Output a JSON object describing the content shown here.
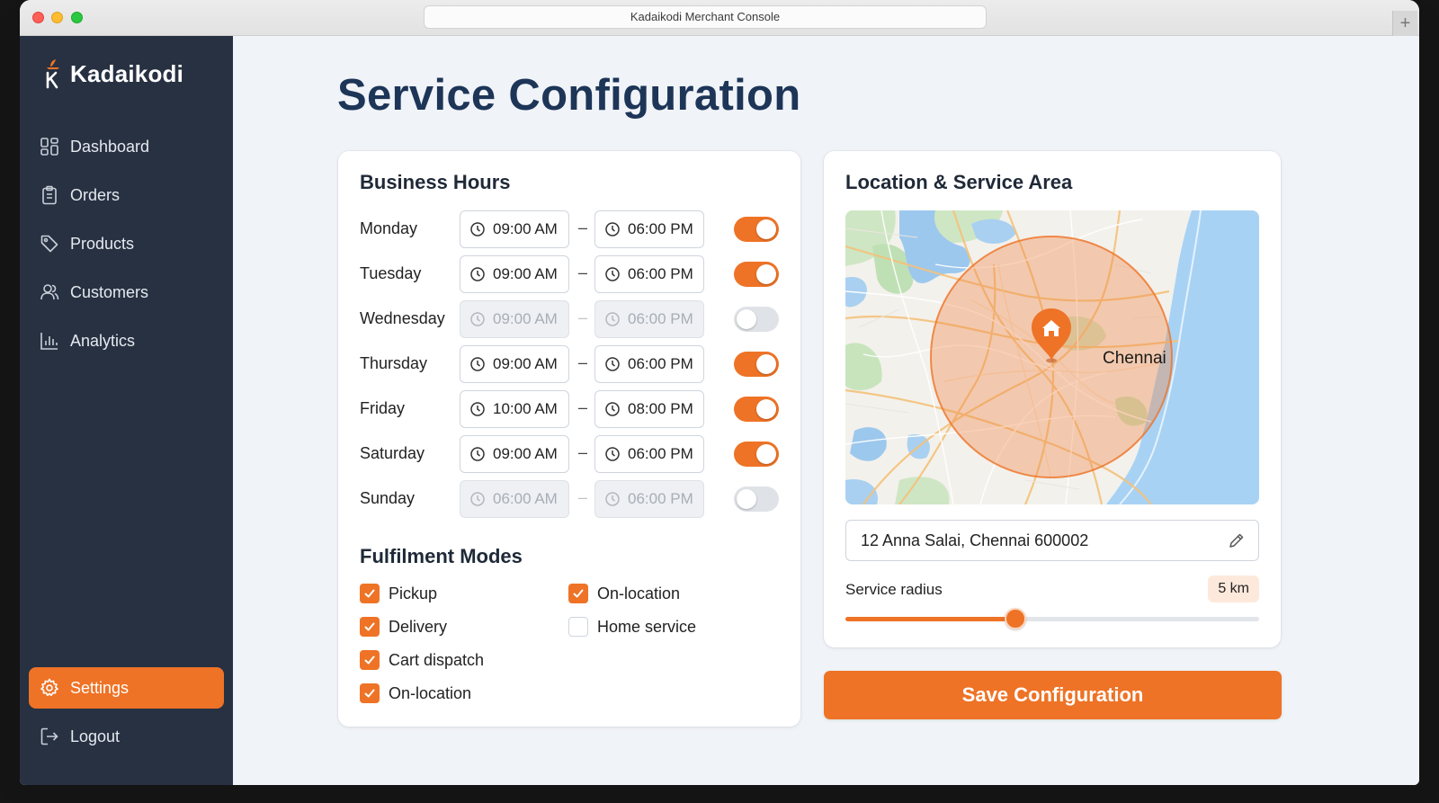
{
  "window": {
    "title": "Kadaikodi Merchant Console",
    "new_tab": "+"
  },
  "brand": {
    "name": "Kadaikodi"
  },
  "sidebar": {
    "items": [
      {
        "label": "Dashboard",
        "icon": "dashboard-icon"
      },
      {
        "label": "Orders",
        "icon": "clipboard-icon"
      },
      {
        "label": "Products",
        "icon": "tag-icon"
      },
      {
        "label": "Customers",
        "icon": "users-icon"
      },
      {
        "label": "Analytics",
        "icon": "bar-chart-icon"
      },
      {
        "label": "Settings",
        "icon": "gear-icon",
        "active": true
      },
      {
        "label": "Logout",
        "icon": "logout-icon"
      }
    ]
  },
  "page": {
    "title": "Service Configuration"
  },
  "business_hours": {
    "title": "Business Hours",
    "separator": "–",
    "days": [
      {
        "name": "Monday",
        "open": "09:00 AM",
        "close": "06:00 PM",
        "enabled": true
      },
      {
        "name": "Tuesday",
        "open": "09:00 AM",
        "close": "06:00 PM",
        "enabled": true
      },
      {
        "name": "Wednesday",
        "open": "09:00 AM",
        "close": "06:00 PM",
        "enabled": false
      },
      {
        "name": "Thursday",
        "open": "09:00 AM",
        "close": "06:00 PM",
        "enabled": true
      },
      {
        "name": "Friday",
        "open": "10:00 AM",
        "close": "08:00 PM",
        "enabled": true
      },
      {
        "name": "Saturday",
        "open": "09:00 AM",
        "close": "06:00 PM",
        "enabled": true
      },
      {
        "name": "Sunday",
        "open": "06:00 AM",
        "close": "06:00 PM",
        "enabled": false
      }
    ]
  },
  "fulfilment": {
    "title": "Fulfilment Modes",
    "options": [
      {
        "label": "Pickup",
        "checked": true
      },
      {
        "label": "Delivery",
        "checked": true
      },
      {
        "label": "Cart dispatch",
        "checked": true
      },
      {
        "label": "On-location",
        "checked": true
      },
      {
        "label": "On-location",
        "checked": true
      },
      {
        "label": "Home service",
        "checked": false
      }
    ]
  },
  "location": {
    "title": "Location & Service Area",
    "map_city_label": "Chennai",
    "address": "12 Anna Salai, Chennai 600002",
    "radius_label": "Service radius",
    "radius_value": "5 km",
    "radius_fraction": 0.41
  },
  "actions": {
    "save_label": "Save Configuration"
  },
  "colors": {
    "accent": "#ee7326",
    "sidebar": "#273142",
    "title": "#1d3557",
    "background": "#f0f3f8"
  }
}
